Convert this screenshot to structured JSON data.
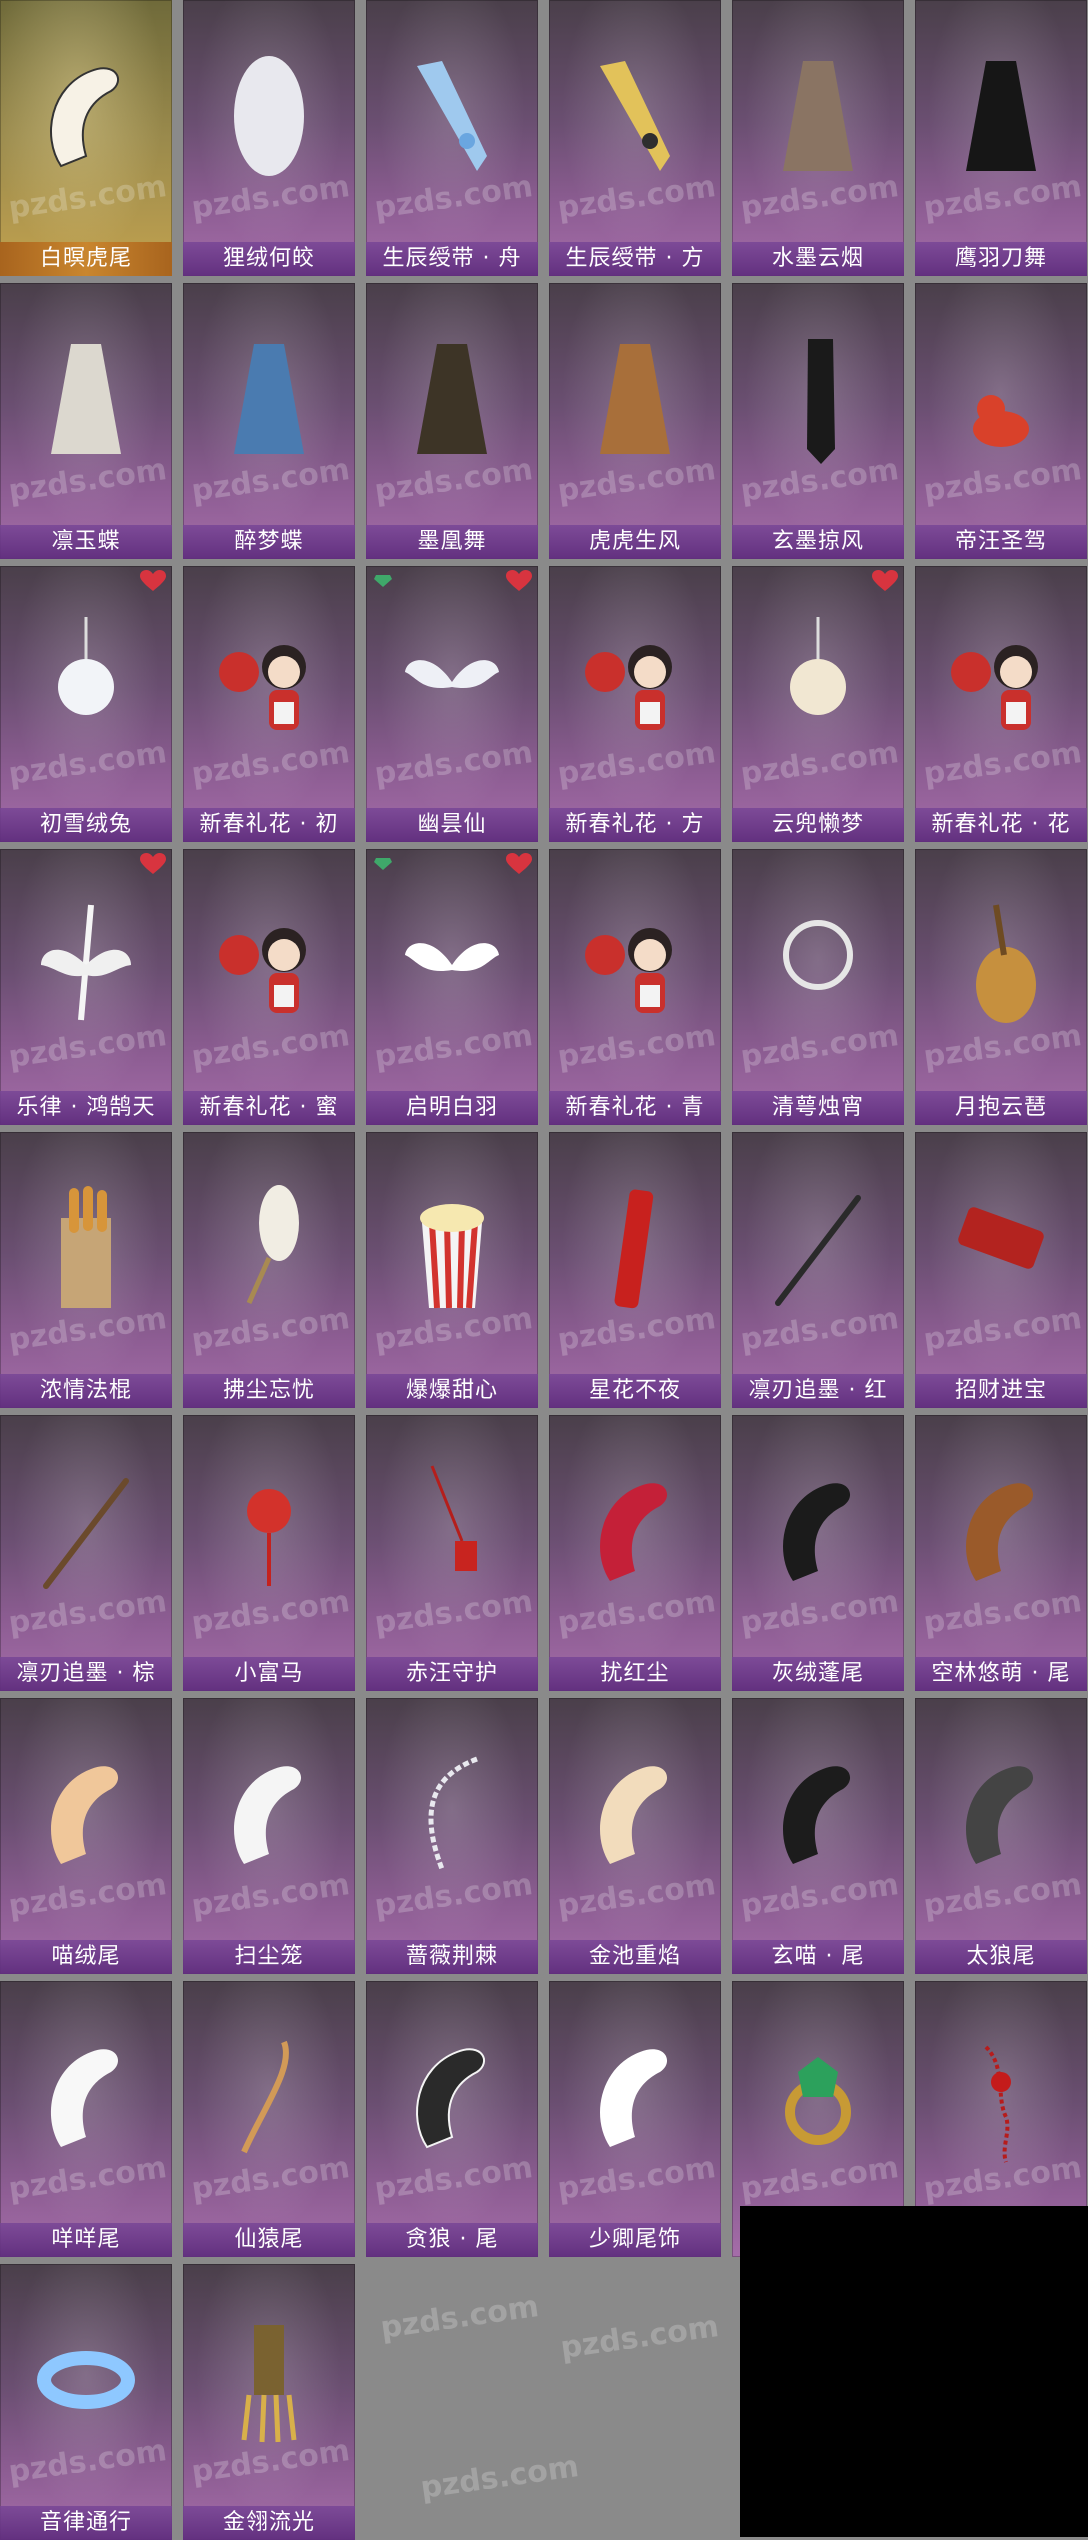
{
  "watermark": "pzds.com",
  "colors": {
    "label_bg": "#6a3a8c",
    "label_text": "#ffffff",
    "heart": "#d8343f",
    "gem": "#3fa86a",
    "selected_label_bg": "#b8742a",
    "page_bg": "#8a8a8a"
  },
  "items": [
    {
      "name": "白暝虎尾",
      "icon": "white-tiger-tail-icon",
      "selected": true
    },
    {
      "name": "狸绒何皎",
      "icon": "white-fur-icon"
    },
    {
      "name": "生辰绶带 · 舟",
      "icon": "blue-ribbon-icon"
    },
    {
      "name": "生辰绶带 · 方",
      "icon": "gold-ribbon-icon"
    },
    {
      "name": "水墨云烟",
      "icon": "ink-robe-icon"
    },
    {
      "name": "鹰羽刀舞",
      "icon": "black-feather-icon"
    },
    {
      "name": "凛玉蝶",
      "icon": "white-butterfly-wings-icon"
    },
    {
      "name": "醉梦蝶",
      "icon": "blue-butterfly-wings-icon"
    },
    {
      "name": "墨凰舞",
      "icon": "dark-phoenix-wings-icon"
    },
    {
      "name": "虎虎生风",
      "icon": "tiger-costume-icon"
    },
    {
      "name": "玄墨掠风",
      "icon": "black-banner-icon"
    },
    {
      "name": "帝汪圣驾",
      "icon": "red-fox-charm-icon"
    },
    {
      "name": "初雪绒兔",
      "icon": "snow-rabbit-charm-icon",
      "heart": true
    },
    {
      "name": "新春礼花 · 初",
      "icon": "chibi-fan-icon"
    },
    {
      "name": "幽昙仙",
      "icon": "white-wings-icon",
      "heart": true,
      "gem": true
    },
    {
      "name": "新春礼花 · 方",
      "icon": "chibi-fan-icon"
    },
    {
      "name": "云兜懒梦",
      "icon": "cat-bag-icon",
      "heart": true
    },
    {
      "name": "新春礼花 · 花",
      "icon": "chibi-fan-icon"
    },
    {
      "name": "乐律 · 鸿鹄天",
      "icon": "winged-guitar-icon",
      "heart": true
    },
    {
      "name": "新春礼花 · 蜜",
      "icon": "chibi-fan-icon"
    },
    {
      "name": "启明白羽",
      "icon": "angel-wings-icon",
      "heart": true,
      "gem": true
    },
    {
      "name": "新春礼花 · 青",
      "icon": "chibi-fan-icon"
    },
    {
      "name": "清萼烛宵",
      "icon": "lotus-wreath-icon"
    },
    {
      "name": "月抱云琶",
      "icon": "pipa-lute-icon"
    },
    {
      "name": "浓情法棍",
      "icon": "baguette-bag-icon"
    },
    {
      "name": "拂尘忘忧",
      "icon": "whisk-icon"
    },
    {
      "name": "爆爆甜心",
      "icon": "popcorn-icon"
    },
    {
      "name": "星花不夜",
      "icon": "firework-tube-icon"
    },
    {
      "name": "凛刃追墨 · 红",
      "icon": "dark-sword-icon"
    },
    {
      "name": "招财进宝",
      "icon": "red-scroll-icon"
    },
    {
      "name": "凛刃追墨 · 棕",
      "icon": "brown-sword-icon"
    },
    {
      "name": "小富马",
      "icon": "horse-charm-icon"
    },
    {
      "name": "赤汪守护",
      "icon": "red-tassel-charm-icon"
    },
    {
      "name": "扰红尘",
      "icon": "red-tail-icon"
    },
    {
      "name": "灰绒蓬尾",
      "icon": "black-fluffy-tail-icon"
    },
    {
      "name": "空林悠萌 · 尾",
      "icon": "raccoon-tail-icon"
    },
    {
      "name": "喵绒尾",
      "icon": "orange-cat-tail-icon"
    },
    {
      "name": "扫尘笼",
      "icon": "white-curved-tail-icon"
    },
    {
      "name": "蔷薇荆棘",
      "icon": "bone-tail-icon"
    },
    {
      "name": "金池重焰",
      "icon": "cream-tail-icon"
    },
    {
      "name": "玄喵 · 尾",
      "icon": "black-cat-tail-icon"
    },
    {
      "name": "太狼尾",
      "icon": "gray-wolf-tail-icon"
    },
    {
      "name": "咩咩尾",
      "icon": "white-puff-tail-icon"
    },
    {
      "name": "仙猿尾",
      "icon": "monkey-tail-icon"
    },
    {
      "name": "贪狼 · 尾",
      "icon": "black-white-tail-icon"
    },
    {
      "name": "少卿尾饰",
      "icon": "white-long-tail-icon"
    },
    {
      "name": "",
      "icon": "emerald-ring-icon"
    },
    {
      "name": "",
      "icon": "red-bead-string-icon"
    },
    {
      "name": "音律通行",
      "icon": "glowing-bracelet-icon"
    },
    {
      "name": "金翎流光",
      "icon": "golden-claw-icon"
    }
  ]
}
